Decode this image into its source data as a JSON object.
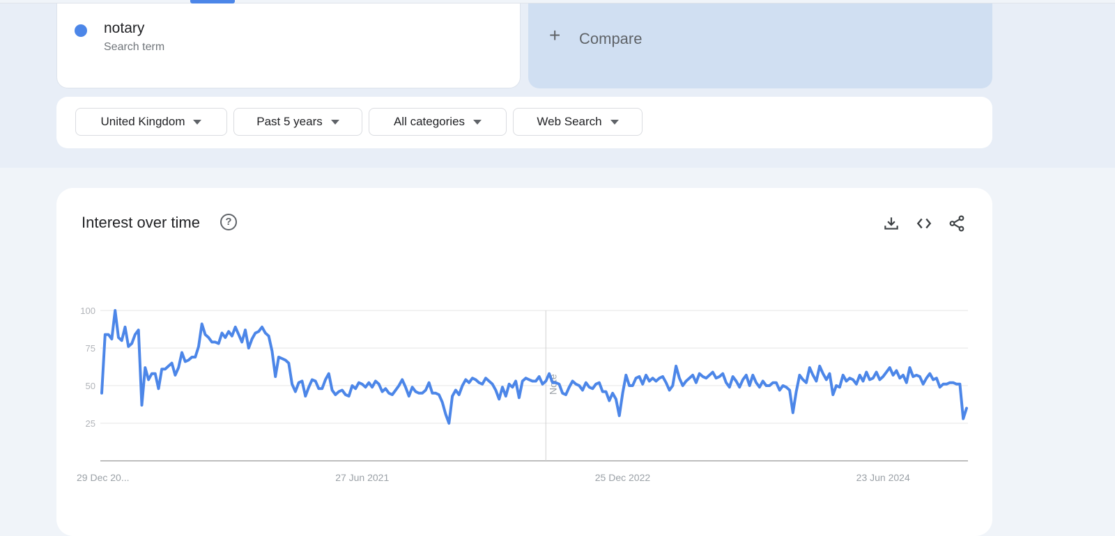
{
  "colors": {
    "series": "#4c86e8",
    "compare_bg": "#d0dff2",
    "grid": "#e6e6e6",
    "axis_text": "#9aa0a6"
  },
  "search_term": {
    "name": "notary",
    "type": "Search term"
  },
  "compare": {
    "icon": "plus-icon",
    "label": "Compare"
  },
  "filters": [
    {
      "label": "United Kingdom"
    },
    {
      "label": "Past 5 years"
    },
    {
      "label": "All categories"
    },
    {
      "label": "Web Search"
    }
  ],
  "interest_card": {
    "title": "Interest over time",
    "help_icon": "?",
    "actions": [
      "download-icon",
      "embed-code-icon",
      "share-icon"
    ]
  },
  "chart_data": {
    "type": "line",
    "title": "Interest over time",
    "xlabel": "",
    "ylabel": "",
    "ylim": [
      0,
      100
    ],
    "yticks": [
      25,
      50,
      75,
      100
    ],
    "grid": true,
    "xtick_labels": [
      "29 Dec 20...",
      "27 Jun 2021",
      "25 Dec 2022",
      "23 Jun 2024"
    ],
    "xtick_indices": [
      0,
      78,
      156,
      234
    ],
    "annotation": {
      "label": "Note",
      "index": 133
    },
    "series": [
      {
        "name": "notary",
        "values": [
          45,
          84,
          84,
          81,
          100,
          82,
          80,
          89,
          76,
          78,
          84,
          87,
          37,
          62,
          54,
          58,
          58,
          48,
          61,
          61,
          63,
          65,
          57,
          62,
          72,
          66,
          67,
          69,
          69,
          76,
          91,
          84,
          82,
          79,
          79,
          78,
          85,
          82,
          86,
          83,
          89,
          84,
          79,
          87,
          75,
          81,
          85,
          86,
          89,
          85,
          83,
          73,
          56,
          69,
          68,
          67,
          65,
          51,
          46,
          52,
          53,
          43,
          49,
          54,
          53,
          48,
          48,
          54,
          58,
          47,
          44,
          46,
          47,
          44,
          43,
          50,
          48,
          52,
          51,
          49,
          52,
          49,
          53,
          51,
          46,
          48,
          45,
          44,
          47,
          50,
          54,
          49,
          43,
          49,
          46,
          45,
          45,
          47,
          52,
          45,
          45,
          44,
          39,
          31,
          25,
          43,
          47,
          44,
          50,
          54,
          52,
          55,
          54,
          52,
          51,
          55,
          53,
          51,
          47,
          41,
          49,
          43,
          51,
          49,
          53,
          42,
          53,
          55,
          54,
          53,
          53,
          56,
          51,
          53,
          58,
          52,
          52,
          51,
          45,
          44,
          49,
          53,
          51,
          50,
          47,
          52,
          49,
          48,
          51,
          52,
          46,
          46,
          40,
          45,
          41,
          30,
          45,
          57,
          50,
          50,
          55,
          56,
          51,
          57,
          53,
          55,
          53,
          55,
          56,
          52,
          47,
          50,
          63,
          55,
          50,
          53,
          55,
          57,
          52,
          58,
          56,
          55,
          57,
          59,
          55,
          56,
          58,
          52,
          49,
          56,
          53,
          49,
          54,
          57,
          50,
          57,
          52,
          49,
          53,
          50,
          50,
          52,
          52,
          47,
          50,
          49,
          47,
          32,
          46,
          57,
          54,
          52,
          62,
          57,
          53,
          63,
          58,
          54,
          58,
          44,
          50,
          49,
          57,
          53,
          55,
          54,
          51,
          57,
          53,
          59,
          54,
          55,
          59,
          54,
          56,
          59,
          62,
          57,
          60,
          55,
          57,
          52,
          62,
          56,
          57,
          56,
          51,
          55,
          58,
          54,
          55,
          49,
          51,
          51,
          52,
          52,
          51,
          51,
          28,
          35
        ]
      }
    ]
  }
}
